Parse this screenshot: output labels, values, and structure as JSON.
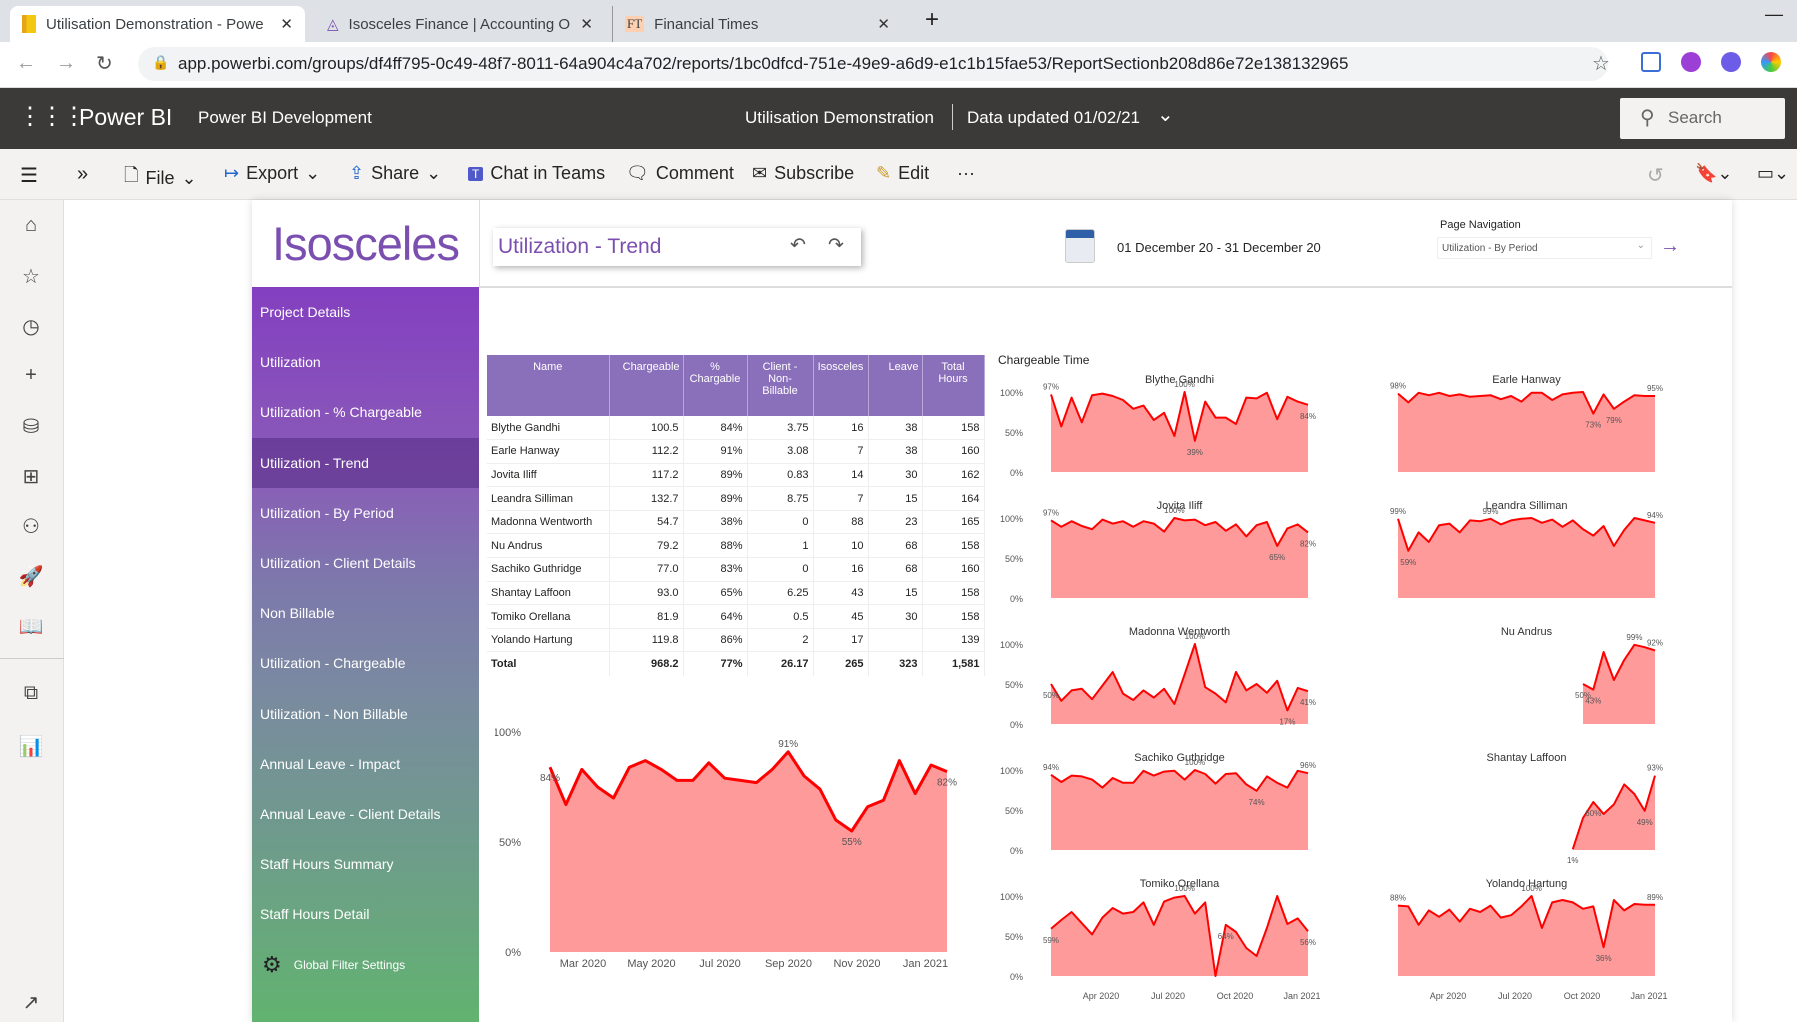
{
  "browser": {
    "tabs": [
      {
        "title": "Utilisation Demonstration - Powe",
        "icon": "powerbi-icon"
      },
      {
        "title": "Isosceles Finance | Accounting O",
        "icon": "isosceles-icon"
      },
      {
        "title": "Financial Times",
        "icon": "ft-icon"
      }
    ],
    "url": "app.powerbi.com/groups/df4ff795-0c49-48f7-8011-64a904c4a702/reports/1bc0dfcd-751e-49e9-a6d9-e1c1b15fae53/ReportSectionb208d86e72e138132965"
  },
  "header": {
    "app": "Power BI",
    "workspace": "Power BI Development",
    "report": "Utilisation Demonstration",
    "updated": "Data updated 01/02/21",
    "search": "Search"
  },
  "toolbar": {
    "file": "File",
    "export": "Export",
    "share": "Share",
    "teams": "Chat in Teams",
    "comment": "Comment",
    "subscribe": "Subscribe",
    "edit": "Edit",
    "more": "···"
  },
  "report": {
    "logo": "Isosceles",
    "title": "Utilization - Trend",
    "date_range": "01 December 20 - 31 December 20",
    "page_nav_label": "Page Navigation",
    "page_nav_value": "Utilization - By Period",
    "nav": [
      "Project Details",
      "Utilization",
      "Utilization - % Chargeable",
      "Utilization - Trend",
      "Utilization - By Period",
      "Utilization - Client Details",
      "Non Billable",
      "Utilization - Chargeable",
      "Utilization - Non Billable",
      "Annual Leave - Impact",
      "Annual Leave - Client Details",
      "Staff Hours Summary",
      "Staff Hours Detail"
    ],
    "nav_selected": 3,
    "global_filter": "Global Filter Settings",
    "colors": {
      "accent": "#833fc0",
      "table_header": "#8a6fba",
      "line": "#ff0000",
      "area": "#ff9a9a"
    }
  },
  "table": {
    "columns": [
      "Name",
      "Chargeable",
      "% Chargable",
      "Client - Non-Billable",
      "Isosceles",
      "Leave",
      "Total Hours"
    ],
    "rows": [
      [
        "Blythe Gandhi",
        "100.5",
        "84%",
        "3.75",
        "16",
        "38",
        "158"
      ],
      [
        "Earle Hanway",
        "112.2",
        "91%",
        "3.08",
        "7",
        "38",
        "160"
      ],
      [
        "Jovita Iliff",
        "117.2",
        "89%",
        "0.83",
        "14",
        "30",
        "162"
      ],
      [
        "Leandra Silliman",
        "132.7",
        "89%",
        "8.75",
        "7",
        "15",
        "164"
      ],
      [
        "Madonna Wentworth",
        "54.7",
        "38%",
        "0",
        "88",
        "23",
        "165"
      ],
      [
        "Nu Andrus",
        "79.2",
        "88%",
        "1",
        "10",
        "68",
        "158"
      ],
      [
        "Sachiko Guthridge",
        "77.0",
        "83%",
        "0",
        "16",
        "68",
        "160"
      ],
      [
        "Shantay Laffoon",
        "93.0",
        "65%",
        "6.25",
        "43",
        "15",
        "158"
      ],
      [
        "Tomiko Orellana",
        "81.9",
        "64%",
        "0.5",
        "45",
        "30",
        "158"
      ],
      [
        "Yolando Hartung",
        "119.8",
        "86%",
        "2",
        "17",
        "",
        "139"
      ]
    ],
    "total": [
      "Total",
      "968.2",
      "77%",
      "26.17",
      "265",
      "323",
      "1,581"
    ]
  },
  "chart_data": [
    {
      "type": "area",
      "ylim": [
        0,
        100
      ],
      "yticks": [
        "0%",
        "50%",
        "100%"
      ],
      "xticks": [
        "Mar 2020",
        "May 2020",
        "Jul 2020",
        "Sep 2020",
        "Nov 2020",
        "Jan 2021"
      ],
      "x_range": [
        "2020-02-03",
        "2021-01-18"
      ],
      "values": [
        84,
        67,
        83,
        75,
        70,
        84,
        87,
        83,
        78,
        78,
        86,
        79,
        78,
        77,
        83,
        91,
        80,
        74,
        60,
        55,
        66,
        69,
        87,
        72,
        85,
        82
      ],
      "labeled": [
        0,
        15,
        19,
        25
      ]
    },
    {
      "type": "area",
      "title": "Chargeable Time",
      "small_multiples": true,
      "ylim": [
        0,
        100
      ],
      "yticks": [
        "0%",
        "50%",
        "100%"
      ],
      "xticks": [
        "Apr 2020",
        "Jul 2020",
        "Oct 2020",
        "Jan 2021"
      ],
      "x_range": [
        "2020-02-03",
        "2021-01-18"
      ],
      "series": [
        {
          "name": "Blythe Gandhi",
          "values": [
            97,
            57,
            93,
            62,
            96,
            98,
            95,
            90,
            79,
            83,
            65,
            74,
            45,
            100,
            39,
            88,
            68,
            68,
            60,
            93,
            92,
            99,
            66,
            94,
            88,
            84
          ],
          "labeled": [
            0,
            13,
            14,
            25
          ]
        },
        {
          "name": "Earle Hanway",
          "values": [
            98,
            87,
            99,
            96,
            99,
            95,
            97,
            94,
            95,
            96,
            91,
            95,
            88,
            99,
            99,
            90,
            97,
            99,
            100,
            73,
            97,
            79,
            88,
            96,
            95,
            95
          ],
          "labeled": [
            0,
            19,
            21,
            25
          ]
        },
        {
          "name": "Jovita Iliff",
          "values": [
            97,
            89,
            96,
            90,
            86,
            98,
            93,
            96,
            89,
            96,
            93,
            83,
            100,
            97,
            98,
            91,
            95,
            84,
            92,
            77,
            91,
            95,
            65,
            87,
            92,
            82
          ],
          "labeled": [
            0,
            12,
            22,
            25
          ]
        },
        {
          "name": "Leandra Silliman",
          "values": [
            99,
            59,
            82,
            70,
            91,
            93,
            82,
            97,
            96,
            99,
            92,
            97,
            99,
            100,
            94,
            98,
            89,
            97,
            86,
            78,
            90,
            65,
            85,
            100,
            97,
            94
          ],
          "labeled": [
            0,
            1,
            9,
            25
          ]
        },
        {
          "name": "Madonna Wentworth",
          "values": [
            50,
            29,
            42,
            44,
            31,
            48,
            65,
            38,
            30,
            42,
            33,
            44,
            25,
            62,
            100,
            46,
            38,
            27,
            65,
            42,
            50,
            39,
            54,
            17,
            45,
            41
          ],
          "labeled": [
            0,
            14,
            23,
            25
          ]
        },
        {
          "name": "Nu Andrus",
          "values": [
            null,
            null,
            null,
            null,
            null,
            null,
            null,
            null,
            null,
            null,
            null,
            null,
            null,
            null,
            null,
            null,
            null,
            null,
            50,
            43,
            90,
            55,
            80,
            99,
            96,
            92
          ],
          "labeled": [
            18,
            19,
            23,
            25
          ]
        },
        {
          "name": "Sachiko Guthridge",
          "values": [
            94,
            85,
            93,
            92,
            88,
            78,
            90,
            84,
            84,
            99,
            93,
            98,
            99,
            88,
            100,
            95,
            83,
            95,
            96,
            82,
            74,
            92,
            84,
            78,
            99,
            96
          ],
          "labeled": [
            0,
            14,
            20,
            25
          ]
        },
        {
          "name": "Shantay Laffoon",
          "values": [
            null,
            null,
            null,
            null,
            null,
            null,
            null,
            null,
            null,
            null,
            null,
            null,
            null,
            null,
            null,
            null,
            null,
            1,
            40,
            60,
            45,
            57,
            82,
            70,
            49,
            93
          ],
          "labeled": [
            17,
            19,
            24,
            25
          ]
        },
        {
          "name": "Tomiko Orellana",
          "values": [
            59,
            70,
            80,
            66,
            52,
            73,
            85,
            78,
            80,
            92,
            64,
            93,
            98,
            100,
            78,
            92,
            0,
            64,
            55,
            35,
            25,
            60,
            100,
            65,
            72,
            56
          ],
          "labeled": [
            0,
            13,
            17,
            25
          ]
        },
        {
          "name": "Yolando Hartung",
          "values": [
            88,
            87,
            64,
            82,
            74,
            83,
            68,
            84,
            80,
            88,
            73,
            76,
            87,
            100,
            60,
            92,
            95,
            92,
            84,
            87,
            36,
            95,
            82,
            90,
            89,
            89
          ],
          "labeled": [
            0,
            13,
            20,
            25
          ]
        }
      ]
    }
  ]
}
